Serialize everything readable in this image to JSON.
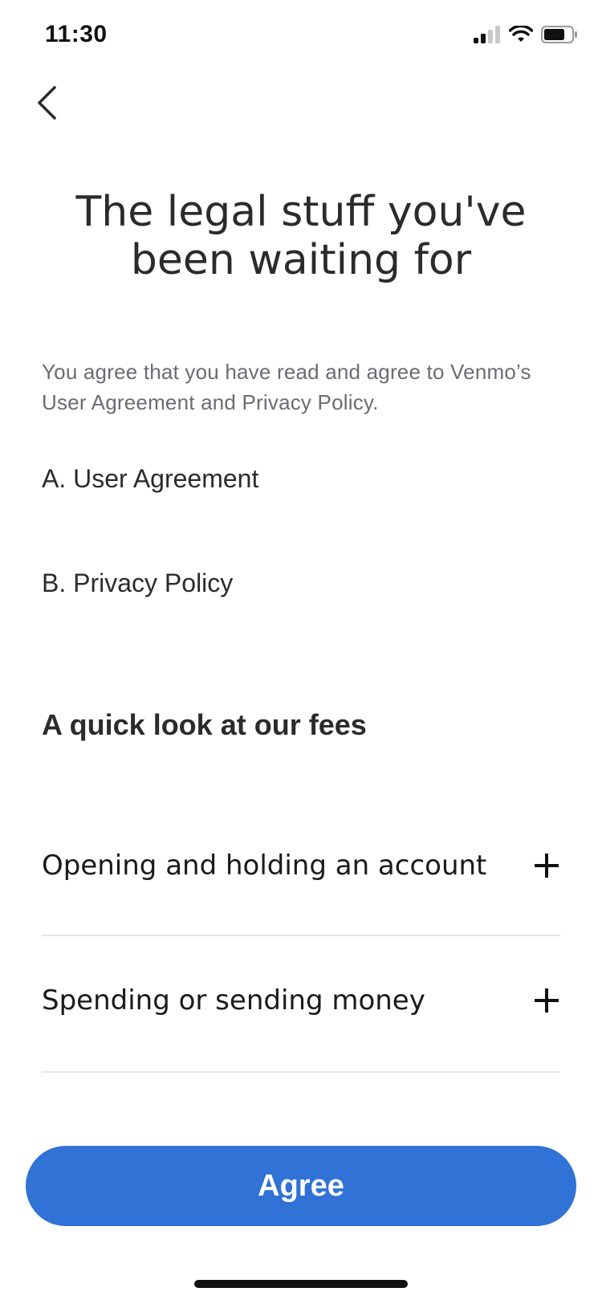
{
  "status_bar": {
    "time": "11:30"
  },
  "header": {
    "back_icon": "chevron-left-icon"
  },
  "title": "The legal stuff you've been waiting for",
  "intro": "You agree that you have read and agree to Venmo’s User Agreement and Privacy Policy.",
  "legal_links": [
    {
      "label": "A. User Agreement"
    },
    {
      "label": "B. Privacy Policy"
    }
  ],
  "fees": {
    "heading": "A quick look at our fees",
    "items": [
      {
        "label": "Opening and holding an account",
        "icon": "plus-icon"
      },
      {
        "label": "Spending or sending money",
        "icon": "plus-icon"
      }
    ]
  },
  "agree_button": {
    "label": "Agree"
  },
  "colors": {
    "accent": "#3072d6",
    "text": "#2b2b2b",
    "muted_text": "#6b6b73",
    "divider": "#e5e5e8"
  }
}
